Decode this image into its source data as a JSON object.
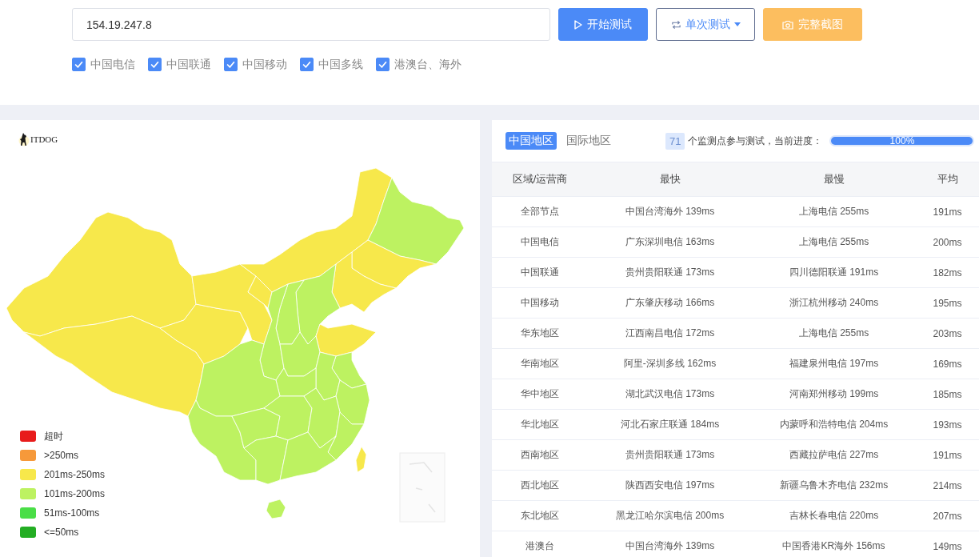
{
  "test_form": {
    "address": {
      "value": "154.19.247.8"
    },
    "buttons": [
      {
        "kind": "start",
        "label": "开始测试"
      },
      {
        "kind": "mode",
        "label": "单次测试"
      },
      {
        "kind": "screenshot",
        "label": "完整截图"
      }
    ],
    "isp_filters": [
      {
        "label": "中国电信",
        "checked": true
      },
      {
        "label": "中国联通",
        "checked": true
      },
      {
        "label": "中国移动",
        "checked": true
      },
      {
        "label": "中国多线",
        "checked": true
      },
      {
        "label": "港澳台、海外",
        "checked": true
      }
    ]
  },
  "map_panel": {
    "logo": {
      "text": "ITDOG"
    },
    "legend": [
      {
        "label": "超时",
        "color": "#e81c1c"
      },
      {
        "label": ">250ms",
        "color": "#f6993a"
      },
      {
        "label": "201ms-250ms",
        "color": "#f7e84b"
      },
      {
        "label": "101ms-200ms",
        "color": "#bdf261"
      },
      {
        "label": "51ms-100ms",
        "color": "#4ade47"
      },
      {
        "label": "<=50ms",
        "color": "#23ad23"
      }
    ]
  },
  "results_panel": {
    "tabs": [
      {
        "label": "中国地区",
        "selected": true
      },
      {
        "label": "国际地区",
        "selected": false
      }
    ],
    "monitor_count": "71",
    "progress_label": "个监测点参与测试，当前进度：",
    "progress": {
      "level": 1,
      "reading": "100%"
    },
    "table": {
      "columns": [
        "区域/运营商",
        "最快",
        "最慢",
        "平均"
      ],
      "rows": [
        [
          "全部节点",
          "中国台湾海外 139ms",
          "上海电信 255ms",
          "191ms"
        ],
        [
          "中国电信",
          "广东深圳电信 163ms",
          "上海电信 255ms",
          "200ms"
        ],
        [
          "中国联通",
          "贵州贵阳联通 173ms",
          "四川德阳联通 191ms",
          "182ms"
        ],
        [
          "中国移动",
          "广东肇庆移动 166ms",
          "浙江杭州移动 240ms",
          "195ms"
        ],
        [
          "华东地区",
          "江西南昌电信 172ms",
          "上海电信 255ms",
          "203ms"
        ],
        [
          "华南地区",
          "阿里-深圳多线 162ms",
          "福建泉州电信 197ms",
          "169ms"
        ],
        [
          "华中地区",
          "湖北武汉电信 173ms",
          "河南郑州移动 199ms",
          "185ms"
        ],
        [
          "华北地区",
          "河北石家庄联通 184ms",
          "内蒙呼和浩特电信 204ms",
          "193ms"
        ],
        [
          "西南地区",
          "贵州贵阳联通 173ms",
          "西藏拉萨电信 227ms",
          "191ms"
        ],
        [
          "西北地区",
          "陕西西安电信 197ms",
          "新疆乌鲁木齐电信 232ms",
          "214ms"
        ],
        [
          "东北地区",
          "黑龙江哈尔滨电信 200ms",
          "吉林长春电信 220ms",
          "207ms"
        ],
        [
          "港澳台",
          "中国台湾海外 139ms",
          "中国香港KR海外 156ms",
          "149ms"
        ]
      ]
    }
  }
}
